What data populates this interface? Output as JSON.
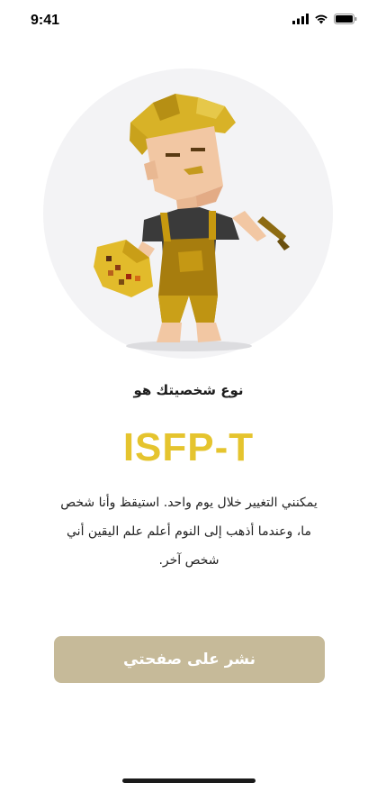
{
  "status_bar": {
    "time": "9:41"
  },
  "hero": {
    "icons": [
      "painter-character-illustration"
    ]
  },
  "result": {
    "subtitle": "نوع شخصيتك هو",
    "type_code": "ISFP-T",
    "description": "يمكنني التغيير خلال يوم واحد. استيقظ وأنا شخص ما، وعندما أذهب إلى النوم أعلم علم اليقين أني شخص آخر."
  },
  "actions": {
    "share_label": "نشر على صفحتي"
  },
  "colors": {
    "accent": "#e5c42e",
    "button": "#c6ba99",
    "circle": "#f3f3f5"
  }
}
